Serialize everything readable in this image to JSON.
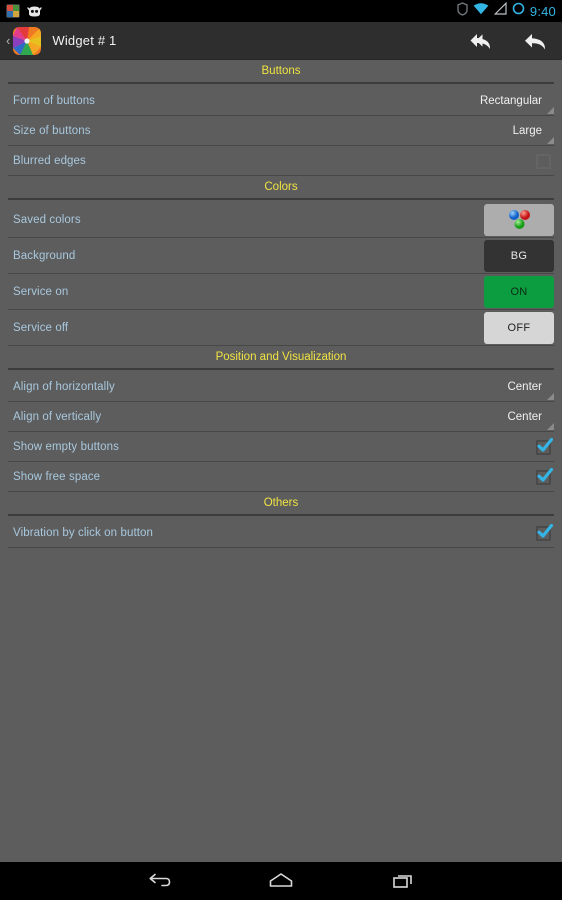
{
  "statusbar": {
    "left_icons": [
      "app-tile-icon",
      "cyanogen-robot-icon"
    ],
    "right_icons": [
      "shield-icon",
      "wifi-icon",
      "signal-icon",
      "circle-icon"
    ],
    "time": "9:40",
    "accent_color": "#33b5e5"
  },
  "actionbar": {
    "back_caret": "‹",
    "app_icon": "pinwheel-app-icon",
    "title": "Widget # 1",
    "actions": [
      {
        "name": "undo-all-button",
        "icon": "double-back-arrow-icon"
      },
      {
        "name": "undo-button",
        "icon": "back-arrow-icon"
      }
    ]
  },
  "sections": [
    {
      "title": "Buttons",
      "rows": [
        {
          "label": "Form of buttons",
          "control": "spinner",
          "value": "Rectangular"
        },
        {
          "label": "Size of buttons",
          "control": "spinner",
          "value": "Large"
        },
        {
          "label": "Blurred edges",
          "control": "checkbox",
          "checked": false
        }
      ]
    },
    {
      "title": "Colors",
      "rows": [
        {
          "label": "Saved colors",
          "control": "color-swatch",
          "swatch": "saved",
          "value": ""
        },
        {
          "label": "Background",
          "control": "color-swatch",
          "swatch": "bg",
          "value": "BG"
        },
        {
          "label": "Service on",
          "control": "color-swatch",
          "swatch": "on",
          "value": "ON"
        },
        {
          "label": "Service off",
          "control": "color-swatch",
          "swatch": "off",
          "value": "OFF"
        }
      ]
    },
    {
      "title": "Position and Visualization",
      "rows": [
        {
          "label": "Align of horizontally",
          "control": "spinner",
          "value": "Center"
        },
        {
          "label": "Align of vertically",
          "control": "spinner",
          "value": "Center"
        },
        {
          "label": "Show empty buttons",
          "control": "checkbox",
          "checked": true
        },
        {
          "label": "Show free space",
          "control": "checkbox",
          "checked": true
        }
      ]
    },
    {
      "title": "Others",
      "rows": [
        {
          "label": "Vibration by click on button",
          "control": "checkbox",
          "checked": true
        }
      ]
    }
  ],
  "navbar": {
    "buttons": [
      {
        "name": "nav-back-button",
        "icon": "back-icon"
      },
      {
        "name": "nav-home-button",
        "icon": "home-icon"
      },
      {
        "name": "nav-recents-button",
        "icon": "recents-icon"
      }
    ]
  },
  "colors": {
    "background": "#5d5d5d",
    "section_header": "#f0e442",
    "row_label": "#a8c8de",
    "actionbar": "#2e2e2e",
    "service_on": "#0d9d41",
    "service_off": "#d6d6d6",
    "bg_swatch": "#333333",
    "checkbox_checked": "#33b5e5"
  }
}
